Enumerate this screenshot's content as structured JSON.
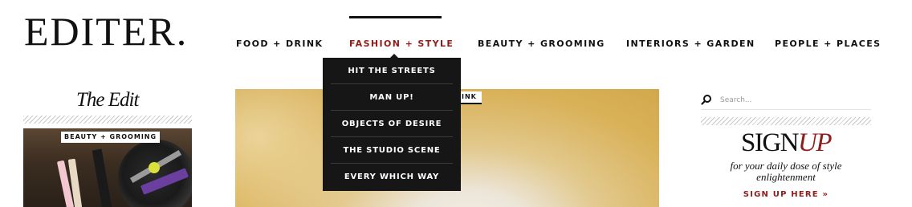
{
  "logo": "EDITER.",
  "nav": {
    "items": [
      {
        "label": "FOOD + DRINK"
      },
      {
        "label": "FASHION + STYLE"
      },
      {
        "label": "BEAUTY + GROOMING"
      },
      {
        "label": "INTERIORS + GARDEN"
      },
      {
        "label": "PEOPLE + PLACES"
      }
    ],
    "active": "FASHION + STYLE",
    "dropdown": [
      {
        "label": "HIT THE STREETS"
      },
      {
        "label": "MAN UP!"
      },
      {
        "label": "OBJECTS OF DESIRE"
      },
      {
        "label": "THE STUDIO SCENE"
      },
      {
        "label": "EVERY WHICH WAY"
      }
    ]
  },
  "sidebar_left": {
    "title": "The Edit",
    "tag": "BEAUTY + GROOMING"
  },
  "hero": {
    "tag_visible": "INK"
  },
  "sidebar_right": {
    "search_placeholder": "Search...",
    "signup_title_main": "SIGN",
    "signup_title_accent": "UP",
    "signup_subtitle": "for your daily dose of style enlightenment",
    "signup_link": "SIGN UP HERE »"
  },
  "colors": {
    "accent": "#8e1e1a",
    "dropdown_bg": "#161616",
    "text": "#111111"
  }
}
